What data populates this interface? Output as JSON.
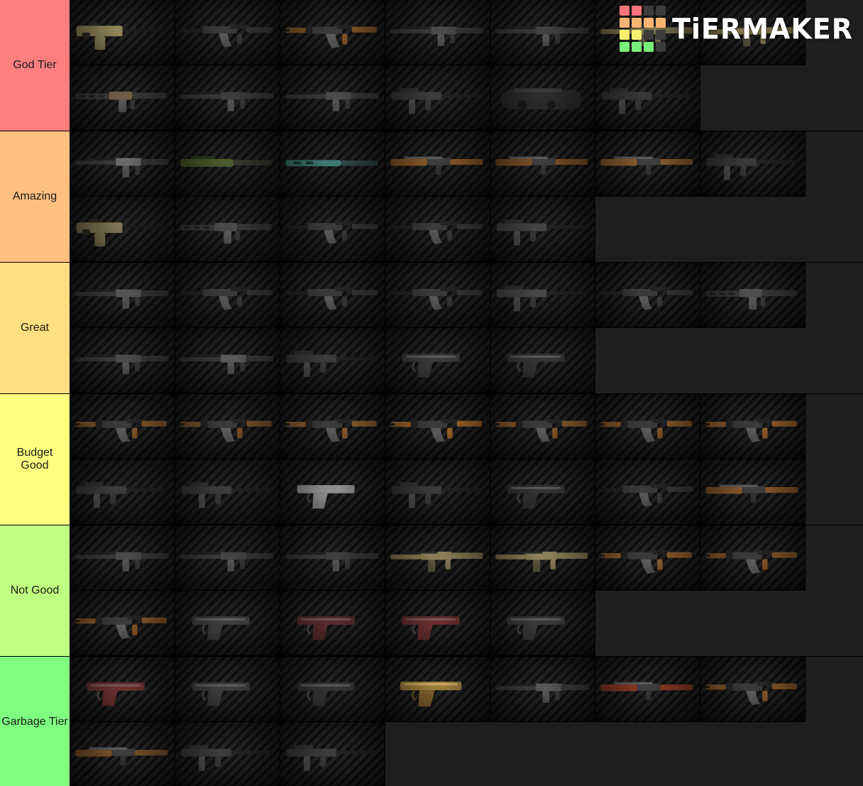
{
  "app": {
    "name": "TierMaker",
    "watermark_text": "TiERMAKER",
    "logo_grid_colors": [
      "#f9737b",
      "#f9737b",
      "#3c3c3c",
      "#3c3c3c",
      "#f9b571",
      "#f9b571",
      "#f9b571",
      "#f9b571",
      "#f6ef6f",
      "#f6ef6f",
      "#3c3c3c",
      "#3c3c3c",
      "#79ef7b",
      "#79ef7b",
      "#79ef7b",
      "#3c3c3c"
    ]
  },
  "tiers": [
    {
      "label": "God Tier",
      "color": "#ff7f7f",
      "item_count": 13,
      "items": [
        {
          "name": "tan-bullpup-rifle",
          "style": "tan-smg",
          "accent": "#8f8559"
        },
        {
          "name": "black-ak-carbine",
          "style": "ak",
          "accent": "#3a3a3a"
        },
        {
          "name": "wood-handguard-ak",
          "style": "ak-wood",
          "accent": "#8a5a2b"
        },
        {
          "name": "suppressed-rifle-top",
          "style": "rifle",
          "accent": "#4a4a4a"
        },
        {
          "name": "black-rifle-receiver",
          "style": "rifle",
          "accent": "#404040"
        },
        {
          "name": "tan-battle-rifle",
          "style": "tan-rifle",
          "accent": "#7c7250"
        },
        {
          "name": "desert-carbine",
          "style": "tan-rifle",
          "accent": "#8a7c52"
        },
        {
          "name": "ar15-keymod-rifle",
          "style": "ar15",
          "accent": "#6d5f45"
        },
        {
          "name": "long-rail-black-rifle",
          "style": "rifle",
          "accent": "#3d3d3d"
        },
        {
          "name": "fal-battle-rifle",
          "style": "rifle",
          "accent": "#4b4b4b"
        },
        {
          "name": "compact-pdw",
          "style": "smg",
          "accent": "#3c3c3c"
        },
        {
          "name": "p90-bullpup-smg",
          "style": "p90",
          "accent": "#2e2e2e"
        },
        {
          "name": "black-machine-pistol",
          "style": "smg",
          "accent": "#383838"
        }
      ]
    },
    {
      "label": "Amazing",
      "color": "#ffbf7f",
      "item_count": 12,
      "items": [
        {
          "name": "bolt-action-rifle",
          "style": "rifle",
          "accent": "#6a6a6a"
        },
        {
          "name": "od-green-rifle",
          "style": "green-rifle",
          "accent": "#4b5a2a"
        },
        {
          "name": "teal-handguard-rifle",
          "style": "teal-rifle",
          "accent": "#3e7a72"
        },
        {
          "name": "wood-stock-shotgun",
          "style": "wood-gun",
          "accent": "#8b5a2b"
        },
        {
          "name": "wood-hunting-rifle",
          "style": "wood-gun",
          "accent": "#7a4f26"
        },
        {
          "name": "wood-double-barrel",
          "style": "wood-gun",
          "accent": "#8a5c2e"
        },
        {
          "name": "black-compact-smg",
          "style": "smg",
          "accent": "#3a3a3a"
        },
        {
          "name": "tan-micro-smg",
          "style": "tan-smg",
          "accent": "#7d7352"
        },
        {
          "name": "m4-carbine",
          "style": "ar15",
          "accent": "#4a4a4a"
        },
        {
          "name": "ak-pdw-folding",
          "style": "ak",
          "accent": "#3f3f3f"
        },
        {
          "name": "ak-74u-carbine",
          "style": "ak",
          "accent": "#3d3d3d"
        },
        {
          "name": "vector-smg",
          "style": "smg",
          "accent": "#454545"
        }
      ]
    },
    {
      "label": "Great",
      "color": "#ffdf80",
      "item_count": 12,
      "items": [
        {
          "name": "bullpup-assault-rifle",
          "style": "rifle",
          "accent": "#555555"
        },
        {
          "name": "ak-103-rifle",
          "style": "ak",
          "accent": "#3c3c3c"
        },
        {
          "name": "ak-74m-rifle",
          "style": "ak",
          "accent": "#3e3e3e"
        },
        {
          "name": "ak-105-carbine",
          "style": "ak",
          "accent": "#3a3a3a"
        },
        {
          "name": "mp5-submachine-gun",
          "style": "smg",
          "accent": "#474747"
        },
        {
          "name": "ak-side-folder",
          "style": "ak",
          "accent": "#3f3f3f"
        },
        {
          "name": "m4a1-carbine",
          "style": "ar15",
          "accent": "#4d4d4d"
        },
        {
          "name": "g3-battle-rifle",
          "style": "rifle",
          "accent": "#4a4a4a"
        },
        {
          "name": "long-barrel-rifle",
          "style": "rifle",
          "accent": "#5a5a5a"
        },
        {
          "name": "mp9-machine-pistol",
          "style": "smg",
          "accent": "#3c3c3c"
        },
        {
          "name": "usp-pistol",
          "style": "pistol",
          "accent": "#3a3a3a"
        },
        {
          "name": "polymer-pistol",
          "style": "pistol",
          "accent": "#353535"
        }
      ]
    },
    {
      "label": "Budget Good",
      "color": "#ffff7f",
      "item_count": 14,
      "items": [
        {
          "name": "wood-furniture-ak",
          "style": "ak-wood",
          "accent": "#8a5a2b"
        },
        {
          "name": "akm-wood-rifle",
          "style": "ak-wood",
          "accent": "#7f5328"
        },
        {
          "name": "ak-47-classic",
          "style": "ak-wood",
          "accent": "#91602f"
        },
        {
          "name": "akm-orange-furniture",
          "style": "ak-wood",
          "accent": "#a5672c"
        },
        {
          "name": "ak-wood-variant",
          "style": "ak-wood",
          "accent": "#8b5a2b"
        },
        {
          "name": "rpk-light-machine-gun",
          "style": "ak-wood",
          "accent": "#8a5a2b"
        },
        {
          "name": "ak-bakelite-rifle",
          "style": "ak-wood",
          "accent": "#96602d"
        },
        {
          "name": "wire-stock-smg",
          "style": "smg",
          "accent": "#3c3c3c"
        },
        {
          "name": "wire-stock-smg-2",
          "style": "smg",
          "accent": "#3c3c3c"
        },
        {
          "name": "stainless-beretta-pistol",
          "style": "pistol",
          "accent": "#8f8f8f"
        },
        {
          "name": "mp5k-machine-pistol",
          "style": "smg",
          "accent": "#3a3a3a"
        },
        {
          "name": "glock-pistol",
          "style": "pistol",
          "accent": "#343434"
        },
        {
          "name": "saiga-shotgun",
          "style": "ak",
          "accent": "#4a4a4a"
        },
        {
          "name": "wood-grip-smg",
          "style": "wood-gun",
          "accent": "#8a5a2b"
        }
      ]
    },
    {
      "label": "Not Good",
      "color": "#bfff7f",
      "item_count": 12,
      "items": [
        {
          "name": "long-rail-dmr",
          "style": "rifle",
          "accent": "#4b4b4b"
        },
        {
          "name": "bullpup-dmr",
          "style": "rifle",
          "accent": "#444444"
        },
        {
          "name": "vss-vintorez-rifle",
          "style": "rifle",
          "accent": "#3e3e3e"
        },
        {
          "name": "tan-bullpup-shotgun",
          "style": "tan-rifle",
          "accent": "#8a7d55"
        },
        {
          "name": "tan-bullpup-rifle-2",
          "style": "tan-rifle",
          "accent": "#8c8058"
        },
        {
          "name": "akm-wood-rifle-2",
          "style": "ak-wood",
          "accent": "#94612e"
        },
        {
          "name": "ak-wood-rifle-3",
          "style": "ak-wood",
          "accent": "#8a5a2b"
        },
        {
          "name": "ak-wood-folding-stock",
          "style": "ak-wood",
          "accent": "#8a5a2b"
        },
        {
          "name": "suppressed-pistol-long",
          "style": "pistol",
          "accent": "#3f3f3f"
        },
        {
          "name": "suppressed-revolver",
          "style": "pistol",
          "accent": "#5a2a2a"
        },
        {
          "name": "wood-grip-pistol",
          "style": "pistol",
          "accent": "#6b2f2f"
        },
        {
          "name": "black-service-pistol",
          "style": "pistol",
          "accent": "#3a3a3a"
        }
      ]
    },
    {
      "label": "Garbage Tier",
      "color": "#7fff7f",
      "item_count": 10,
      "items": [
        {
          "name": "makarov-pistol",
          "style": "pistol",
          "accent": "#6b3030"
        },
        {
          "name": "pm-pistol",
          "style": "pistol",
          "accent": "#3d3d3d"
        },
        {
          "name": "tt-33-pistol",
          "style": "pistol",
          "accent": "#343434"
        },
        {
          "name": "gold-tokarev-pistol",
          "style": "gold-pistol",
          "accent": "#9a7b3c"
        },
        {
          "name": "pump-shotgun",
          "style": "rifle",
          "accent": "#555555"
        },
        {
          "name": "wood-stock-shotgun-2",
          "style": "wood-gun",
          "accent": "#8a3a22"
        },
        {
          "name": "ak-wood-rifle-4",
          "style": "ak-wood",
          "accent": "#8a5a2b"
        },
        {
          "name": "wood-rifle-long",
          "style": "wood-gun",
          "accent": "#7a5128"
        },
        {
          "name": "pp-19-bizon-smg",
          "style": "smg",
          "accent": "#3c3c3c"
        },
        {
          "name": "empty-slot-placeholder",
          "style": "smg",
          "accent": "#3c3c3c"
        }
      ]
    }
  ]
}
